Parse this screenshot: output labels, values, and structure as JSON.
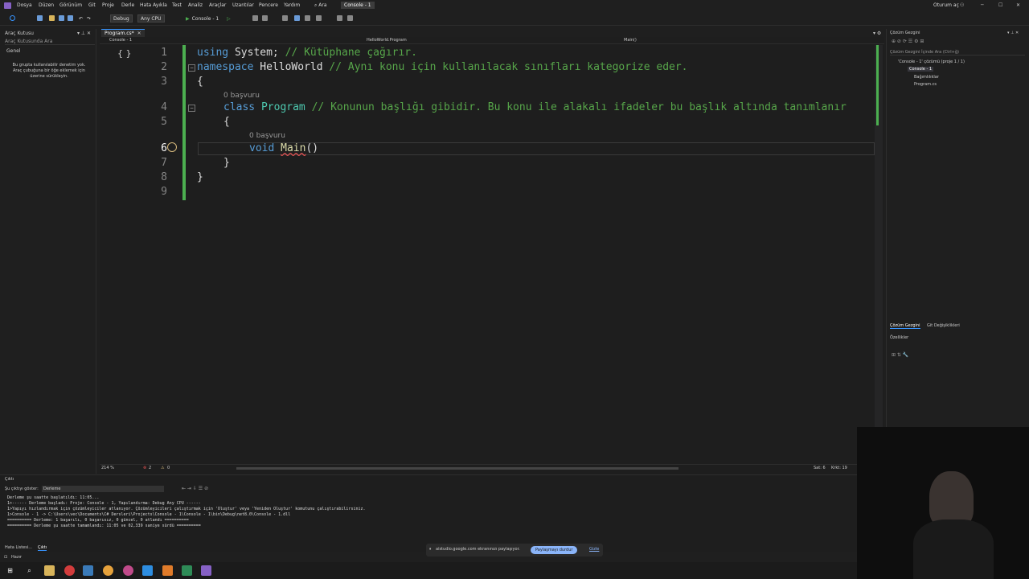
{
  "menu": [
    "Dosya",
    "Düzen",
    "Görünüm",
    "Git",
    "Proje",
    "Derle",
    "Hata Ayıkla",
    "Test",
    "Analiz",
    "Araçlar",
    "Uzantılar",
    "Pencere",
    "Yardım"
  ],
  "search_label": "Ara",
  "solution_title": "Console - 1",
  "signin": "Oturum aç",
  "toolbar": {
    "config": "Debug",
    "platform": "Any CPU",
    "run_target": "Console - 1"
  },
  "toolbox": {
    "title": "Araç Kutusu",
    "search_placeholder": "Araç Kutusunda Ara",
    "group": "Genel",
    "empty_msg": "Bu grupta kullanılabilir denetim yok. Araç çubuğuna bir öğe eklemek için üzerine sürükleyin."
  },
  "editor": {
    "tab_label": "Program.cs*",
    "project_crumb": "Console - 1",
    "class_crumb": "HelloWorld.Program",
    "member_crumb": "Main()",
    "zoom": "214 %",
    "errors": "2",
    "warnings": "0",
    "cursor_line": "Sat: 6",
    "cursor_char": "Krkt: 19",
    "lines": [
      "1",
      "2",
      "3",
      "4",
      "5",
      "6",
      "7",
      "8",
      "9"
    ],
    "refs": [
      "0 başvuru",
      "0 başvuru"
    ],
    "code": {
      "l1_kw": "using",
      "l1_id": "System;",
      "l1_cm": "// Kütüphane çağırır.",
      "l2_kw": "namespace",
      "l2_id": "HelloWorld",
      "l2_cm": "// Aynı konu için kullanılacak sınıfları kategorize eder.",
      "l3": "{",
      "l4_kw": "class",
      "l4_cls": "Program",
      "l4_cm": "// Konunun başlığı gibidir. Bu konu ile alakalı ifadeler bu başlık altında tanımlanır",
      "l5": "{",
      "l6_kw": "void",
      "l6_mth": "Main",
      "l6_rest": "()",
      "l7": "}",
      "l8": "}"
    }
  },
  "solution": {
    "title": "Çözüm Gezgini",
    "search_placeholder": "Çözüm Gezgini İçinde Ara (Ctrl+ğ)",
    "root": "'Console - 1' çözümü (proje 1 / 1)",
    "project": "Console - 1",
    "deps": "Bağımlılıklar",
    "file": "Program.cs",
    "tabs": [
      "Çözüm Gezgini",
      "Git Değişiklikleri"
    ],
    "props_title": "Özellikler"
  },
  "output": {
    "title": "Çıktı",
    "show_label": "Şu çıktıyı göster:",
    "source": "Derleme",
    "lines": [
      "Derleme şu saatte başlatıldı: 11:05...",
      "1>------ Derleme başladı: Proje: Console - 1, Yapılandırma: Debug Any CPU ------",
      "1>Yapıyı hızlandırmak için çözümleyiciler atlanıyor. Çözümleyicileri çalıştırmak için 'Oluştur' veya 'Yeniden Oluştur' komutunu çalıştırabilirsiniz.",
      "1>Console - 1 -> C:\\Users\\vec\\Documents\\C# Dersleri\\Projects\\Console - 1\\Console - 1\\bin\\Debug\\net8.0\\Console - 1.dll",
      "========== Derleme: 1 başarılı, 0 başarısız, 0 güncel, 0 atlandı ==========",
      "========== Derleme şu saatte tamamlandı: 11:05 ve 02,339 saniye sürdü =========="
    ],
    "tabs": [
      "Hata Listesi...",
      "Çıktı"
    ]
  },
  "status": "Hazır",
  "share": {
    "msg": "aistudio.google.com ekranınızı paylaşıyor.",
    "stop": "Paylaşmayı durdur",
    "hide": "Gizle"
  },
  "colors": {
    "accent": "#3794ff",
    "vs_purple": "#8661c5",
    "keyword": "#569cd6",
    "type": "#4ec9b0",
    "comment": "#57a64a",
    "method": "#dcdcaa",
    "share_btn": "#8ab4f8"
  }
}
